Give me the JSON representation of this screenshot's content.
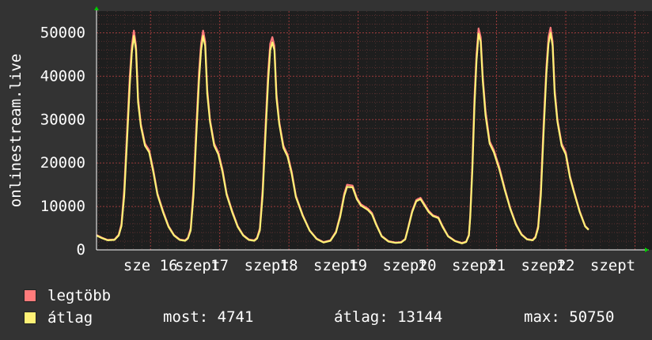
{
  "chart_data": {
    "type": "line",
    "ylabel": "onlinestream.live",
    "yticks": [
      0,
      10000,
      20000,
      30000,
      40000,
      50000
    ],
    "ylim": [
      0,
      55000
    ],
    "xlim": [
      -0.78,
      7.2
    ],
    "xtick_labels": [
      {
        "x": 0,
        "label": "sze 16"
      },
      {
        "x": 0.68,
        "label": "szept"
      },
      {
        "x": 1,
        "label": "17"
      },
      {
        "x": 1.68,
        "label": "szept"
      },
      {
        "x": 2,
        "label": "18"
      },
      {
        "x": 2.68,
        "label": "szept"
      },
      {
        "x": 3,
        "label": "19"
      },
      {
        "x": 3.68,
        "label": "szept"
      },
      {
        "x": 4,
        "label": "20"
      },
      {
        "x": 4.68,
        "label": "szept"
      },
      {
        "x": 5,
        "label": "21"
      },
      {
        "x": 5.68,
        "label": "szept"
      },
      {
        "x": 6,
        "label": "22"
      },
      {
        "x": 6.68,
        "label": "szept"
      }
    ],
    "grid": true,
    "series": [
      {
        "name": "legtöbb",
        "color": "#ff7b7b",
        "points": [
          [
            -0.78,
            3400
          ],
          [
            -0.7,
            2800
          ],
          [
            -0.62,
            2300
          ],
          [
            -0.52,
            2400
          ],
          [
            -0.46,
            3500
          ],
          [
            -0.42,
            6000
          ],
          [
            -0.38,
            14000
          ],
          [
            -0.34,
            27000
          ],
          [
            -0.3,
            40000
          ],
          [
            -0.27,
            47000
          ],
          [
            -0.24,
            50500
          ],
          [
            -0.21,
            47000
          ],
          [
            -0.18,
            35000
          ],
          [
            -0.14,
            29000
          ],
          [
            -0.08,
            24500
          ],
          [
            -0.02,
            23000
          ],
          [
            0.04,
            18500
          ],
          [
            0.1,
            13000
          ],
          [
            0.18,
            9000
          ],
          [
            0.26,
            5500
          ],
          [
            0.34,
            3400
          ],
          [
            0.42,
            2400
          ],
          [
            0.5,
            2200
          ],
          [
            0.54,
            2800
          ],
          [
            0.58,
            5000
          ],
          [
            0.62,
            14000
          ],
          [
            0.66,
            28000
          ],
          [
            0.7,
            41000
          ],
          [
            0.73,
            47500
          ],
          [
            0.76,
            50500
          ],
          [
            0.79,
            48000
          ],
          [
            0.82,
            37000
          ],
          [
            0.86,
            30000
          ],
          [
            0.92,
            24500
          ],
          [
            0.98,
            22500
          ],
          [
            1.04,
            18500
          ],
          [
            1.1,
            13000
          ],
          [
            1.18,
            9000
          ],
          [
            1.26,
            5500
          ],
          [
            1.34,
            3400
          ],
          [
            1.42,
            2400
          ],
          [
            1.5,
            2200
          ],
          [
            1.54,
            2800
          ],
          [
            1.58,
            5000
          ],
          [
            1.62,
            14000
          ],
          [
            1.66,
            28000
          ],
          [
            1.7,
            41000
          ],
          [
            1.73,
            47500
          ],
          [
            1.76,
            49000
          ],
          [
            1.79,
            47000
          ],
          [
            1.82,
            36000
          ],
          [
            1.86,
            29500
          ],
          [
            1.92,
            24000
          ],
          [
            1.98,
            22000
          ],
          [
            2.04,
            18000
          ],
          [
            2.1,
            12500
          ],
          [
            2.2,
            8000
          ],
          [
            2.3,
            4500
          ],
          [
            2.4,
            2600
          ],
          [
            2.5,
            1800
          ],
          [
            2.6,
            2200
          ],
          [
            2.68,
            4200
          ],
          [
            2.74,
            8000
          ],
          [
            2.8,
            13000
          ],
          [
            2.84,
            15000
          ],
          [
            2.92,
            14800
          ],
          [
            2.98,
            12000
          ],
          [
            3.04,
            10500
          ],
          [
            3.14,
            9500
          ],
          [
            3.2,
            8500
          ],
          [
            3.26,
            6000
          ],
          [
            3.34,
            3200
          ],
          [
            3.44,
            2000
          ],
          [
            3.54,
            1700
          ],
          [
            3.62,
            1800
          ],
          [
            3.68,
            2500
          ],
          [
            3.72,
            5000
          ],
          [
            3.78,
            9000
          ],
          [
            3.84,
            11500
          ],
          [
            3.9,
            12000
          ],
          [
            3.96,
            10500
          ],
          [
            4.02,
            9000
          ],
          [
            4.08,
            8000
          ],
          [
            4.16,
            7500
          ],
          [
            4.22,
            5500
          ],
          [
            4.3,
            3200
          ],
          [
            4.4,
            2100
          ],
          [
            4.5,
            1600
          ],
          [
            4.56,
            1900
          ],
          [
            4.6,
            3500
          ],
          [
            4.62,
            8000
          ],
          [
            4.65,
            20000
          ],
          [
            4.68,
            35000
          ],
          [
            4.71,
            45000
          ],
          [
            4.74,
            51000
          ],
          [
            4.77,
            49000
          ],
          [
            4.8,
            40000
          ],
          [
            4.84,
            32000
          ],
          [
            4.9,
            25000
          ],
          [
            4.96,
            23000
          ],
          [
            5.04,
            19000
          ],
          [
            5.12,
            14000
          ],
          [
            5.2,
            9500
          ],
          [
            5.28,
            6000
          ],
          [
            5.36,
            3600
          ],
          [
            5.44,
            2500
          ],
          [
            5.52,
            2300
          ],
          [
            5.56,
            3000
          ],
          [
            5.6,
            5500
          ],
          [
            5.64,
            14000
          ],
          [
            5.68,
            29000
          ],
          [
            5.72,
            42000
          ],
          [
            5.75,
            49000
          ],
          [
            5.78,
            51200
          ],
          [
            5.81,
            48000
          ],
          [
            5.84,
            37000
          ],
          [
            5.88,
            30000
          ],
          [
            5.94,
            24500
          ],
          [
            6.0,
            22500
          ],
          [
            6.06,
            17000
          ],
          [
            6.12,
            13500
          ],
          [
            6.2,
            9000
          ],
          [
            6.28,
            5500
          ],
          [
            6.33,
            4700
          ]
        ]
      },
      {
        "name": "átlag",
        "color": "#fff176",
        "points": [
          [
            -0.78,
            3300
          ],
          [
            -0.7,
            2700
          ],
          [
            -0.62,
            2200
          ],
          [
            -0.52,
            2300
          ],
          [
            -0.46,
            3300
          ],
          [
            -0.42,
            5500
          ],
          [
            -0.38,
            12500
          ],
          [
            -0.34,
            25000
          ],
          [
            -0.3,
            38000
          ],
          [
            -0.27,
            45500
          ],
          [
            -0.24,
            49300
          ],
          [
            -0.21,
            46000
          ],
          [
            -0.18,
            34000
          ],
          [
            -0.14,
            28500
          ],
          [
            -0.08,
            24000
          ],
          [
            -0.02,
            22500
          ],
          [
            0.04,
            18000
          ],
          [
            0.1,
            12700
          ],
          [
            0.18,
            8700
          ],
          [
            0.26,
            5300
          ],
          [
            0.34,
            3300
          ],
          [
            0.42,
            2300
          ],
          [
            0.5,
            2100
          ],
          [
            0.54,
            2600
          ],
          [
            0.58,
            4500
          ],
          [
            0.62,
            12500
          ],
          [
            0.66,
            26000
          ],
          [
            0.7,
            39000
          ],
          [
            0.73,
            46000
          ],
          [
            0.76,
            49300
          ],
          [
            0.79,
            47000
          ],
          [
            0.82,
            36000
          ],
          [
            0.86,
            29500
          ],
          [
            0.92,
            24000
          ],
          [
            0.98,
            22000
          ],
          [
            1.04,
            18000
          ],
          [
            1.1,
            12700
          ],
          [
            1.18,
            8700
          ],
          [
            1.26,
            5300
          ],
          [
            1.34,
            3300
          ],
          [
            1.42,
            2300
          ],
          [
            1.5,
            2100
          ],
          [
            1.54,
            2600
          ],
          [
            1.58,
            4500
          ],
          [
            1.62,
            12500
          ],
          [
            1.66,
            26000
          ],
          [
            1.7,
            39000
          ],
          [
            1.73,
            46000
          ],
          [
            1.76,
            47800
          ],
          [
            1.79,
            46000
          ],
          [
            1.82,
            35000
          ],
          [
            1.86,
            29000
          ],
          [
            1.92,
            23500
          ],
          [
            1.98,
            21500
          ],
          [
            2.04,
            17500
          ],
          [
            2.1,
            12200
          ],
          [
            2.2,
            7800
          ],
          [
            2.3,
            4400
          ],
          [
            2.4,
            2500
          ],
          [
            2.5,
            1700
          ],
          [
            2.6,
            2100
          ],
          [
            2.68,
            4000
          ],
          [
            2.74,
            7600
          ],
          [
            2.8,
            12500
          ],
          [
            2.84,
            14500
          ],
          [
            2.92,
            14400
          ],
          [
            2.98,
            11700
          ],
          [
            3.04,
            10200
          ],
          [
            3.14,
            9200
          ],
          [
            3.2,
            8200
          ],
          [
            3.26,
            5800
          ],
          [
            3.34,
            3100
          ],
          [
            3.44,
            1900
          ],
          [
            3.54,
            1600
          ],
          [
            3.62,
            1700
          ],
          [
            3.68,
            2400
          ],
          [
            3.72,
            4800
          ],
          [
            3.78,
            8700
          ],
          [
            3.84,
            11200
          ],
          [
            3.9,
            11700
          ],
          [
            3.96,
            10200
          ],
          [
            4.02,
            8700
          ],
          [
            4.08,
            7800
          ],
          [
            4.16,
            7300
          ],
          [
            4.22,
            5300
          ],
          [
            4.3,
            3100
          ],
          [
            4.4,
            2000
          ],
          [
            4.5,
            1500
          ],
          [
            4.56,
            1800
          ],
          [
            4.6,
            3300
          ],
          [
            4.62,
            7500
          ],
          [
            4.65,
            18500
          ],
          [
            4.68,
            33000
          ],
          [
            4.71,
            43500
          ],
          [
            4.74,
            49800
          ],
          [
            4.77,
            48000
          ],
          [
            4.8,
            39000
          ],
          [
            4.84,
            31000
          ],
          [
            4.9,
            24500
          ],
          [
            4.96,
            22500
          ],
          [
            5.04,
            18500
          ],
          [
            5.12,
            13700
          ],
          [
            5.2,
            9300
          ],
          [
            5.28,
            5800
          ],
          [
            5.36,
            3500
          ],
          [
            5.44,
            2400
          ],
          [
            5.52,
            2200
          ],
          [
            5.56,
            2800
          ],
          [
            5.6,
            5000
          ],
          [
            5.64,
            12500
          ],
          [
            5.68,
            27000
          ],
          [
            5.72,
            40500
          ],
          [
            5.75,
            47500
          ],
          [
            5.78,
            50000
          ],
          [
            5.81,
            47000
          ],
          [
            5.84,
            36000
          ],
          [
            5.88,
            29500
          ],
          [
            5.94,
            24000
          ],
          [
            6.0,
            22000
          ],
          [
            6.06,
            16700
          ],
          [
            6.12,
            13200
          ],
          [
            6.2,
            8800
          ],
          [
            6.28,
            5400
          ],
          [
            6.33,
            4600
          ]
        ]
      }
    ]
  },
  "legend": {
    "items": [
      {
        "label": "legtöbb",
        "color": "#ff7b7b"
      },
      {
        "label": "átlag",
        "color": "#fff176"
      }
    ],
    "stats": {
      "most": "most: 4741",
      "atlag": "átlag: 13144",
      "max": "max: 50750"
    }
  }
}
